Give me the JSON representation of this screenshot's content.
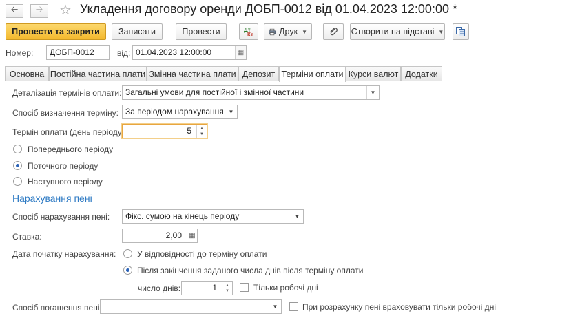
{
  "window": {
    "title": "Укладення договору оренди ДОБП-0012 від 01.04.2023 12:00:00 *"
  },
  "toolbar": {
    "post_close": "Провести та закрити",
    "save": "Записати",
    "post": "Провести",
    "print": "Друк",
    "create_based": "Створити на підставі"
  },
  "header": {
    "number_label": "Номер:",
    "number_value": "ДОБП-0012",
    "date_label": "від:",
    "date_value": "01.04.2023 12:00:00"
  },
  "tabs": [
    {
      "label": "Основна"
    },
    {
      "label": "Постійна частина плати"
    },
    {
      "label": "Змінна частина плати"
    },
    {
      "label": "Депозит"
    },
    {
      "label": "Терміни оплати"
    },
    {
      "label": "Курси валют"
    },
    {
      "label": "Додатки"
    }
  ],
  "active_tab": "Терміни оплати",
  "terms": {
    "detail_label": "Деталізація термінів оплати:",
    "detail_value": "Загальні умови для постійної і змінної частини",
    "method_label": "Спосіб визначення терміну:",
    "method_value": "За періодом нарахування",
    "day_label": "Термін оплати (день періоду):",
    "day_value": "5",
    "period_options": [
      {
        "label": "Попереднього періоду",
        "selected": false
      },
      {
        "label": "Поточного періоду",
        "selected": true
      },
      {
        "label": "Наступного періоду",
        "selected": false
      }
    ]
  },
  "penalty": {
    "section_title": "Нарахування пені",
    "method_label": "Спосіб нарахування пені:",
    "method_value": "Фікс. сумою на кінець періоду",
    "rate_label": "Ставка:",
    "rate_value": "2,00",
    "start_label": "Дата початку нарахування:",
    "start_options": [
      {
        "label": "У відповідності до терміну оплати",
        "selected": false
      },
      {
        "label": "Після закінчення заданого числа днів після терміну оплати",
        "selected": true
      }
    ],
    "days_label": "число днів:",
    "days_value": "1",
    "workdays_only_label": "Тільки робочі дні",
    "workdays_only_checked": false,
    "repay_label": "Спосіб погашення пені:",
    "repay_value": "",
    "calc_workdays_label": "При розрахунку пені враховувати тільки робочі дні",
    "calc_workdays_checked": false
  },
  "colors": {
    "primary_button": "#f4b92e",
    "section_title": "#2f7bc4",
    "focus_border": "#e8a640",
    "radio_dot": "#2b63b8"
  }
}
